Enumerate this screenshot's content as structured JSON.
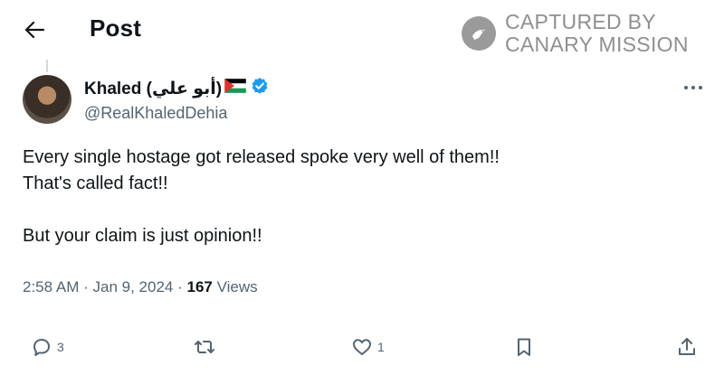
{
  "header": {
    "title": "Post"
  },
  "watermark": {
    "line1": "CAPTURED BY",
    "line2": "CANARY MISSION"
  },
  "author": {
    "display_name": "Khaled (أبو علي)",
    "handle": "@RealKhaledDehia",
    "flag_icon": "palestine-flag-icon",
    "verified_icon": "verified-badge-icon"
  },
  "post": {
    "text_lines": [
      "Every single hostage got released spoke very well of them!!",
      "That's called fact!!",
      "",
      "But your claim is just opinion!!"
    ],
    "time": "2:58 AM",
    "date": "Jan 9, 2024",
    "views_count": "167",
    "views_label": "Views"
  },
  "actions": {
    "reply_count": "3",
    "like_count": "1"
  },
  "colors": {
    "text": "#0f1419",
    "muted": "#536471",
    "verified": "#1d9bf0"
  }
}
